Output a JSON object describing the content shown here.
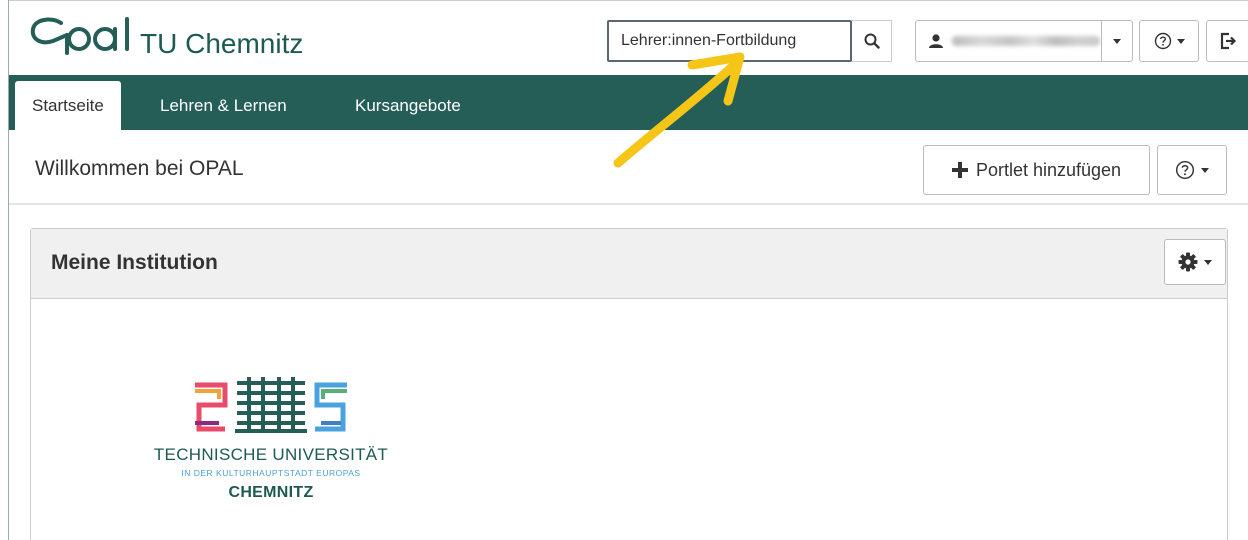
{
  "header": {
    "logo_text": "Opal",
    "institution": "TU Chemnitz",
    "search": {
      "value": "Lehrer:innen-Fortbildung",
      "button_icon": "search-icon"
    },
    "user_menu": {
      "icon": "user-icon",
      "name_blurred": true
    },
    "help_icon": "help-circle-icon",
    "logout_icon": "logout-icon"
  },
  "nav": {
    "tabs": [
      {
        "label": "Startseite",
        "active": true
      },
      {
        "label": "Lehren & Lernen",
        "active": false
      },
      {
        "label": "Kursangebote",
        "active": false
      }
    ]
  },
  "toolbar": {
    "welcome": "Willkommen bei OPAL",
    "add_portlet": "Portlet hinzufügen",
    "add_icon": "plus-icon"
  },
  "panel": {
    "title": "Meine Institution",
    "settings_icon": "gear-icon",
    "logo": {
      "line1": "TECHNISCHE UNIVERSITÄT",
      "line2": "IN DER KULTURHAUPTSTADT EUROPAS",
      "line3": "CHEMNITZ"
    }
  },
  "colors": {
    "brand_green": "#245e57",
    "text": "#333333",
    "annotation_arrow": "#f5c518"
  }
}
